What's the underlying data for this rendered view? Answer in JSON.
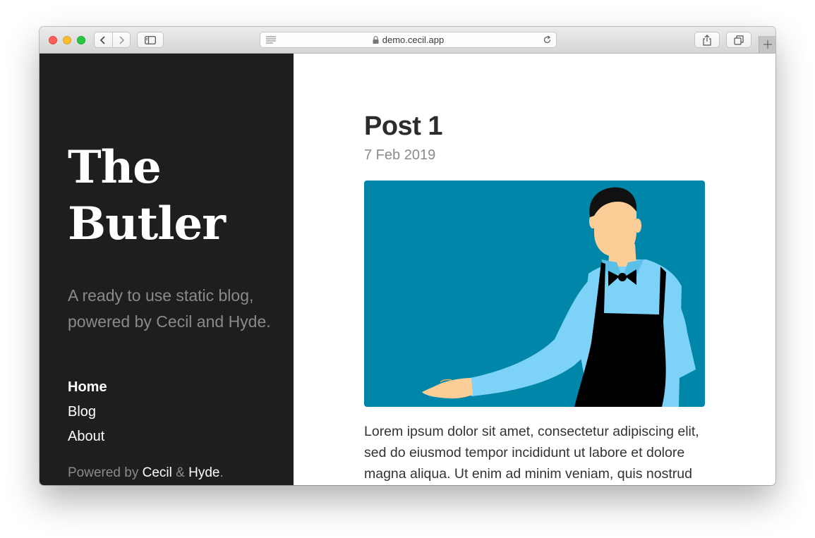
{
  "browser": {
    "url": "demo.cecil.app"
  },
  "site": {
    "title_line1": "The",
    "title_line2": "Butler",
    "tagline": "A ready to use static blog, powered by Cecil and Hyde.",
    "nav": [
      {
        "label": "Home",
        "active": true
      },
      {
        "label": "Blog",
        "active": false
      },
      {
        "label": "About",
        "active": false
      }
    ],
    "powered": {
      "prefix": "Powered by ",
      "link1": "Cecil",
      "separator": " & ",
      "link2": "Hyde",
      "suffix": "."
    }
  },
  "post": {
    "title": "Post 1",
    "date": "7 Feb 2019",
    "body": "Lorem ipsum dolor sit amet, consectetur adipiscing elit, sed do eiusmod tempor incididunt ut labore et dolore magna aliqua. Ut enim ad minim veniam, quis nostrud"
  },
  "colors": {
    "sidebar_bg": "#1e1e1e",
    "image_bg": "#0086a8",
    "shirt": "#7dd3f7",
    "skin": "#fdcd97"
  }
}
